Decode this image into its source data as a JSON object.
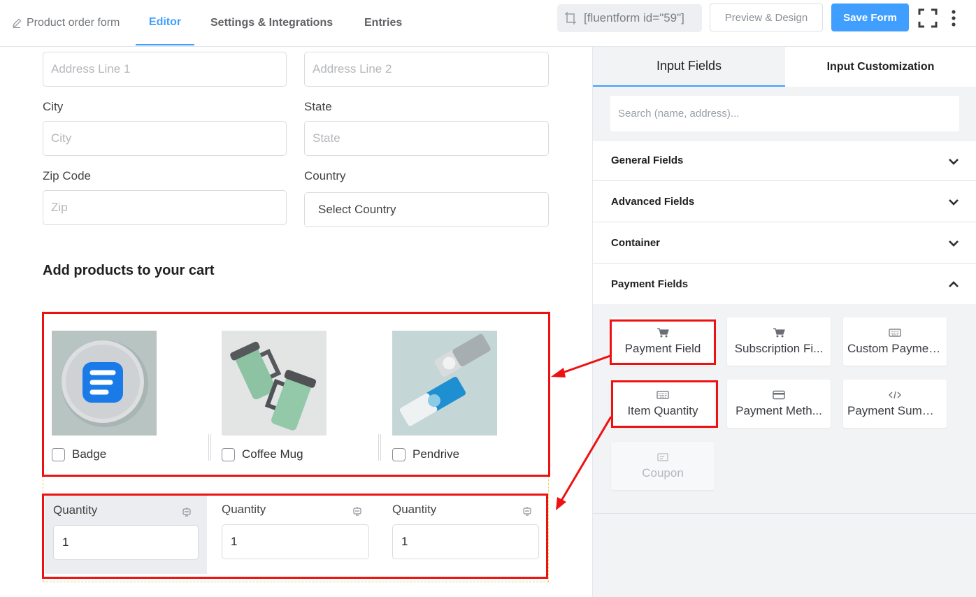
{
  "header": {
    "form_title": "Product order form",
    "tabs": [
      "Editor",
      "Settings & Integrations",
      "Entries"
    ],
    "shortcode": "[fluentform id=\"59\"]",
    "preview_label": "Preview & Design",
    "save_label": "Save Form"
  },
  "editor": {
    "address_line_1_placeholder": "Address Line 1",
    "address_line_2_placeholder": "Address Line 2",
    "city_label": "City",
    "city_placeholder": "City",
    "state_label": "State",
    "state_placeholder": "State",
    "zip_label": "Zip Code",
    "zip_placeholder": "Zip",
    "country_label": "Country",
    "country_value": "Select Country",
    "section_title": "Add products to your cart",
    "products": [
      {
        "name": "Badge"
      },
      {
        "name": "Coffee Mug"
      },
      {
        "name": "Pendrive"
      }
    ],
    "quantities": [
      {
        "label": "Quantity",
        "value": "1"
      },
      {
        "label": "Quantity",
        "value": "1"
      },
      {
        "label": "Quantity",
        "value": "1"
      }
    ]
  },
  "sidebar": {
    "tabs": {
      "input_fields": "Input Fields",
      "input_customization": "Input Customization"
    },
    "search_placeholder": "Search (name, address)...",
    "accordions": [
      "General Fields",
      "Advanced Fields",
      "Container",
      "Payment Fields"
    ],
    "payment_fields": [
      {
        "label": "Payment Field",
        "icon": "cart-icon"
      },
      {
        "label": "Subscription Fi...",
        "icon": "cart-icon"
      },
      {
        "label": "Custom Payment ...",
        "icon": "keyboard-icon"
      },
      {
        "label": "Item Quantity",
        "icon": "keyboard-icon"
      },
      {
        "label": "Payment Meth...",
        "icon": "credit-card-icon"
      },
      {
        "label": "Payment Summary",
        "icon": "code-icon"
      },
      {
        "label": "Coupon",
        "icon": "coupon-icon"
      }
    ]
  },
  "colors": {
    "accent": "#409eff",
    "highlight": "#ee1111"
  }
}
